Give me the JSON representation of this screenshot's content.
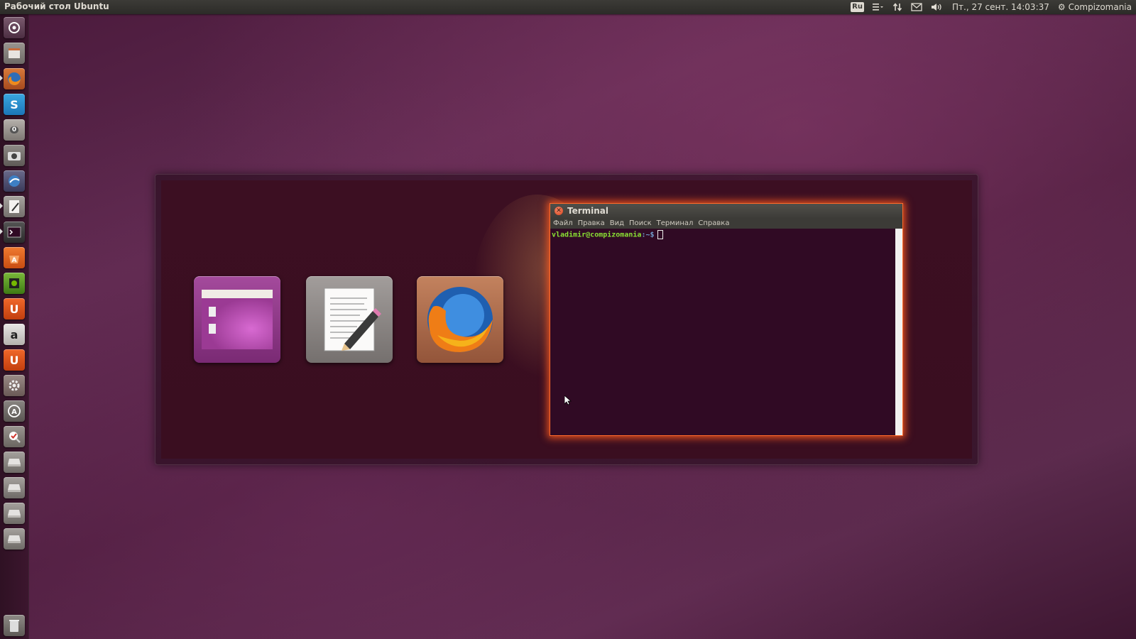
{
  "top_panel": {
    "title": "Рабочий стол Ubuntu",
    "keyboard_layout": "Ru",
    "datetime": "Пт., 27 сент. 14:03:37",
    "user": "Compizomania",
    "icons": [
      "menu-icon",
      "network-icon",
      "mail-icon",
      "volume-icon",
      "gear-icon"
    ]
  },
  "launcher": {
    "items": [
      {
        "name": "dash-home-icon",
        "running": false
      },
      {
        "name": "file-manager-icon",
        "running": false
      },
      {
        "name": "firefox-icon",
        "running": true
      },
      {
        "name": "skype-icon",
        "running": false,
        "label": "S"
      },
      {
        "name": "notification-icon",
        "running": false,
        "badge": "0"
      },
      {
        "name": "screenshot-icon",
        "running": false
      },
      {
        "name": "thunderbird-icon",
        "running": false
      },
      {
        "name": "text-editor-icon",
        "running": true
      },
      {
        "name": "terminal-icon",
        "running": true
      },
      {
        "name": "software-center-icon",
        "running": false
      },
      {
        "name": "nvidia-settings-icon",
        "running": false
      },
      {
        "name": "ubuntu-one-icon",
        "running": false,
        "label": "U"
      },
      {
        "name": "amazon-icon",
        "running": false,
        "label": "a"
      },
      {
        "name": "ubuntu-one-music-icon",
        "running": false,
        "label": "U"
      },
      {
        "name": "system-settings-icon",
        "running": false
      },
      {
        "name": "software-updater-icon",
        "running": false
      },
      {
        "name": "tweak-tool-icon",
        "running": false
      },
      {
        "name": "drive-icon-1",
        "running": false
      },
      {
        "name": "drive-icon-2",
        "running": false
      },
      {
        "name": "drive-icon-3",
        "running": false
      },
      {
        "name": "drive-icon-4",
        "running": false
      }
    ],
    "trash": "trash-icon"
  },
  "switcher": {
    "apps": [
      {
        "name": "file-manager",
        "color": "#9b3a94"
      },
      {
        "name": "text-editor",
        "color": "#8a8584"
      },
      {
        "name": "firefox",
        "color": "#b5724f"
      }
    ],
    "terminal": {
      "title": "Terminal",
      "menu": [
        "Файл",
        "Правка",
        "Вид",
        "Поиск",
        "Терминал",
        "Справка"
      ],
      "prompt_user": "vladimir@compizomania",
      "prompt_path": ":~$"
    }
  },
  "colors": {
    "accent_glow": "#ff6a2a",
    "terminal_bg": "#300a24",
    "prompt_green": "#8ae234"
  }
}
